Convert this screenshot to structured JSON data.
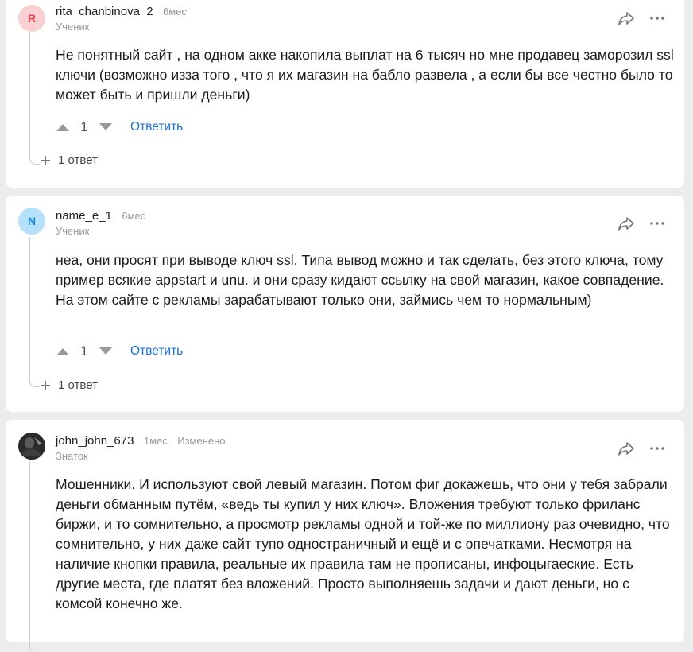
{
  "comments": [
    {
      "avatar_letter": "R",
      "username": "rita_chanbinova_2",
      "time": "6мес",
      "role": "Ученик",
      "text": "Не понятный сайт , на одном акке накопила выплат на 6 тысяч но мне продавец заморозил ssl ключи  (возможно изза того , что  я их  магазин на бабло развела , а если бы все честно было то может быть и пришли деньги)",
      "votes": "1",
      "reply_label": "Ответить",
      "answers_label": "1 ответ"
    },
    {
      "avatar_letter": "N",
      "username": "name_e_1",
      "time": "6мес",
      "role": "Ученик",
      "text": "неа, они просят при выводе ключ ssl. Типа вывод можно и так сделать, без этого ключа, тому пример всякие appstart и unu. и они сразу кидают ссылку на свой магазин, какое совпадение. На этом сайте с рекламы зарабатывают только они, займись чем то нормальным)",
      "votes": "1",
      "reply_label": "Ответить",
      "answers_label": "1 ответ"
    },
    {
      "username": "john_john_673",
      "time": "1мес",
      "edited": "Изменено",
      "role": "Знаток",
      "text": "Мошенники. И используют свой левый магазин. Потом фиг докажешь, что они у тебя забрали деньги обманным путём, «ведь ты купил у них ключ». Вложения требуют только фриланс биржи, и то сомнительно, а просмотр рекламы одной и той-же по миллиону раз очевидно, что сомнительно, у них даже сайт тупо одностраничный и ещё и с опечатками. Несмотря на наличие кнопки правила, реальные их правила там не прописаны, инфоцыгаеские. Есть другие места, где платят без вложений. Просто выполняешь задачи и дают деньги, но с комсой конечно же."
    }
  ],
  "icons": {
    "share": "share-arrow-icon",
    "more": "more-dots-icon",
    "upvote": "upvote-triangle-icon",
    "downvote": "downvote-triangle-icon",
    "expand": "plus-icon"
  },
  "colors": {
    "link": "#1d6fd1",
    "avatar_r_bg": "#fbd0d2",
    "avatar_r_fg": "#e24754",
    "avatar_n_bg": "#b6e1fb",
    "avatar_n_fg": "#1a8ad6"
  }
}
